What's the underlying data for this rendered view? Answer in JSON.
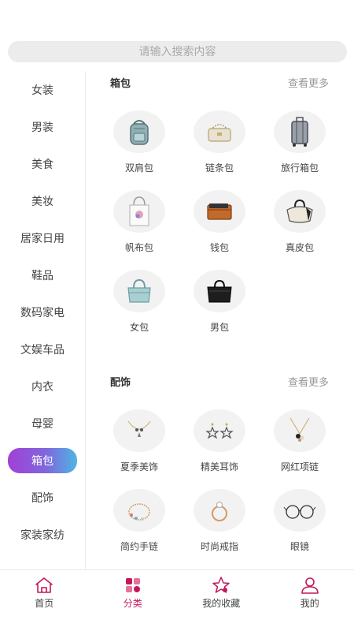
{
  "search": {
    "placeholder": "请输入搜索内容"
  },
  "sidebar": {
    "items": [
      {
        "label": "女装"
      },
      {
        "label": "男装"
      },
      {
        "label": "美食"
      },
      {
        "label": "美妆"
      },
      {
        "label": "居家日用"
      },
      {
        "label": "鞋品"
      },
      {
        "label": "数码家电"
      },
      {
        "label": "文娱车品"
      },
      {
        "label": "内衣"
      },
      {
        "label": "母婴"
      },
      {
        "label": "箱包"
      },
      {
        "label": "配饰"
      },
      {
        "label": "家装家纺"
      }
    ],
    "active_label": "箱包"
  },
  "sections": [
    {
      "title": "箱包",
      "more": "查看更多",
      "items": [
        {
          "label": "双肩包",
          "icon": "backpack-icon"
        },
        {
          "label": "链条包",
          "icon": "chain-bag-icon"
        },
        {
          "label": "旅行箱包",
          "icon": "suitcase-icon"
        },
        {
          "label": "帆布包",
          "icon": "canvas-tote-icon"
        },
        {
          "label": "钱包",
          "icon": "wallet-icon"
        },
        {
          "label": "真皮包",
          "icon": "leather-bag-icon"
        },
        {
          "label": "女包",
          "icon": "handbag-icon"
        },
        {
          "label": "男包",
          "icon": "briefcase-icon"
        }
      ]
    },
    {
      "title": "配饰",
      "more": "查看更多",
      "items": [
        {
          "label": "夏季美饰",
          "icon": "necklace-icon"
        },
        {
          "label": "精美耳饰",
          "icon": "earrings-icon"
        },
        {
          "label": "网红项链",
          "icon": "pendant-necklace-icon"
        },
        {
          "label": "简约手链",
          "icon": "bracelet-icon"
        },
        {
          "label": "时尚戒指",
          "icon": "ring-icon"
        },
        {
          "label": "眼镜",
          "icon": "glasses-icon"
        }
      ]
    }
  ],
  "tabbar": {
    "tabs": [
      {
        "label": "首页",
        "icon": "home-icon"
      },
      {
        "label": "分类",
        "icon": "category-icon"
      },
      {
        "label": "我的收藏",
        "icon": "star-icon"
      },
      {
        "label": "我的",
        "icon": "user-icon"
      }
    ],
    "active_label": "分类"
  },
  "colors": {
    "accent": "#c2185b",
    "pill_start": "#a23fd6",
    "pill_end": "#4fb6e3"
  }
}
